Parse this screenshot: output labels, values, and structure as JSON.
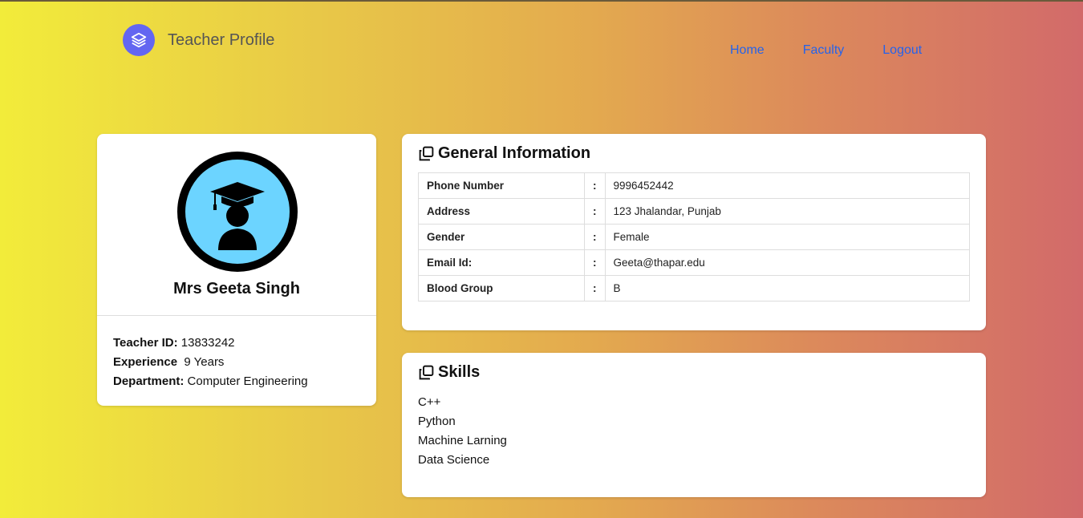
{
  "header": {
    "brand_title": "Teacher Profile",
    "brand_icon": "layers-icon",
    "brand_color": "#6366f1",
    "nav": [
      {
        "label": "Home"
      },
      {
        "label": "Faculty"
      },
      {
        "label": "Logout"
      }
    ]
  },
  "profile": {
    "avatar_icon": "graduate-avatar-icon",
    "avatar_bg": "#6cd4ff",
    "name": "Mrs Geeta Singh",
    "teacher_id_label": "Teacher ID:",
    "teacher_id": "13833242",
    "experience_label": "Experience",
    "experience": "9 Years",
    "department_label": "Department:",
    "department": "Computer Engineering"
  },
  "general_info": {
    "title": "General Information",
    "separator": ":",
    "rows": [
      {
        "label": "Phone Number",
        "value": "9996452442"
      },
      {
        "label": "Address",
        "value": "123 Jhalandar, Punjab"
      },
      {
        "label": "Gender",
        "value": "Female"
      },
      {
        "label": "Email Id:",
        "value": "Geeta@thapar.edu"
      },
      {
        "label": "Blood Group",
        "value": "B"
      }
    ]
  },
  "skills": {
    "title": "Skills",
    "items": [
      "C++",
      "Python",
      "Machine Larning",
      "Data Science"
    ]
  }
}
